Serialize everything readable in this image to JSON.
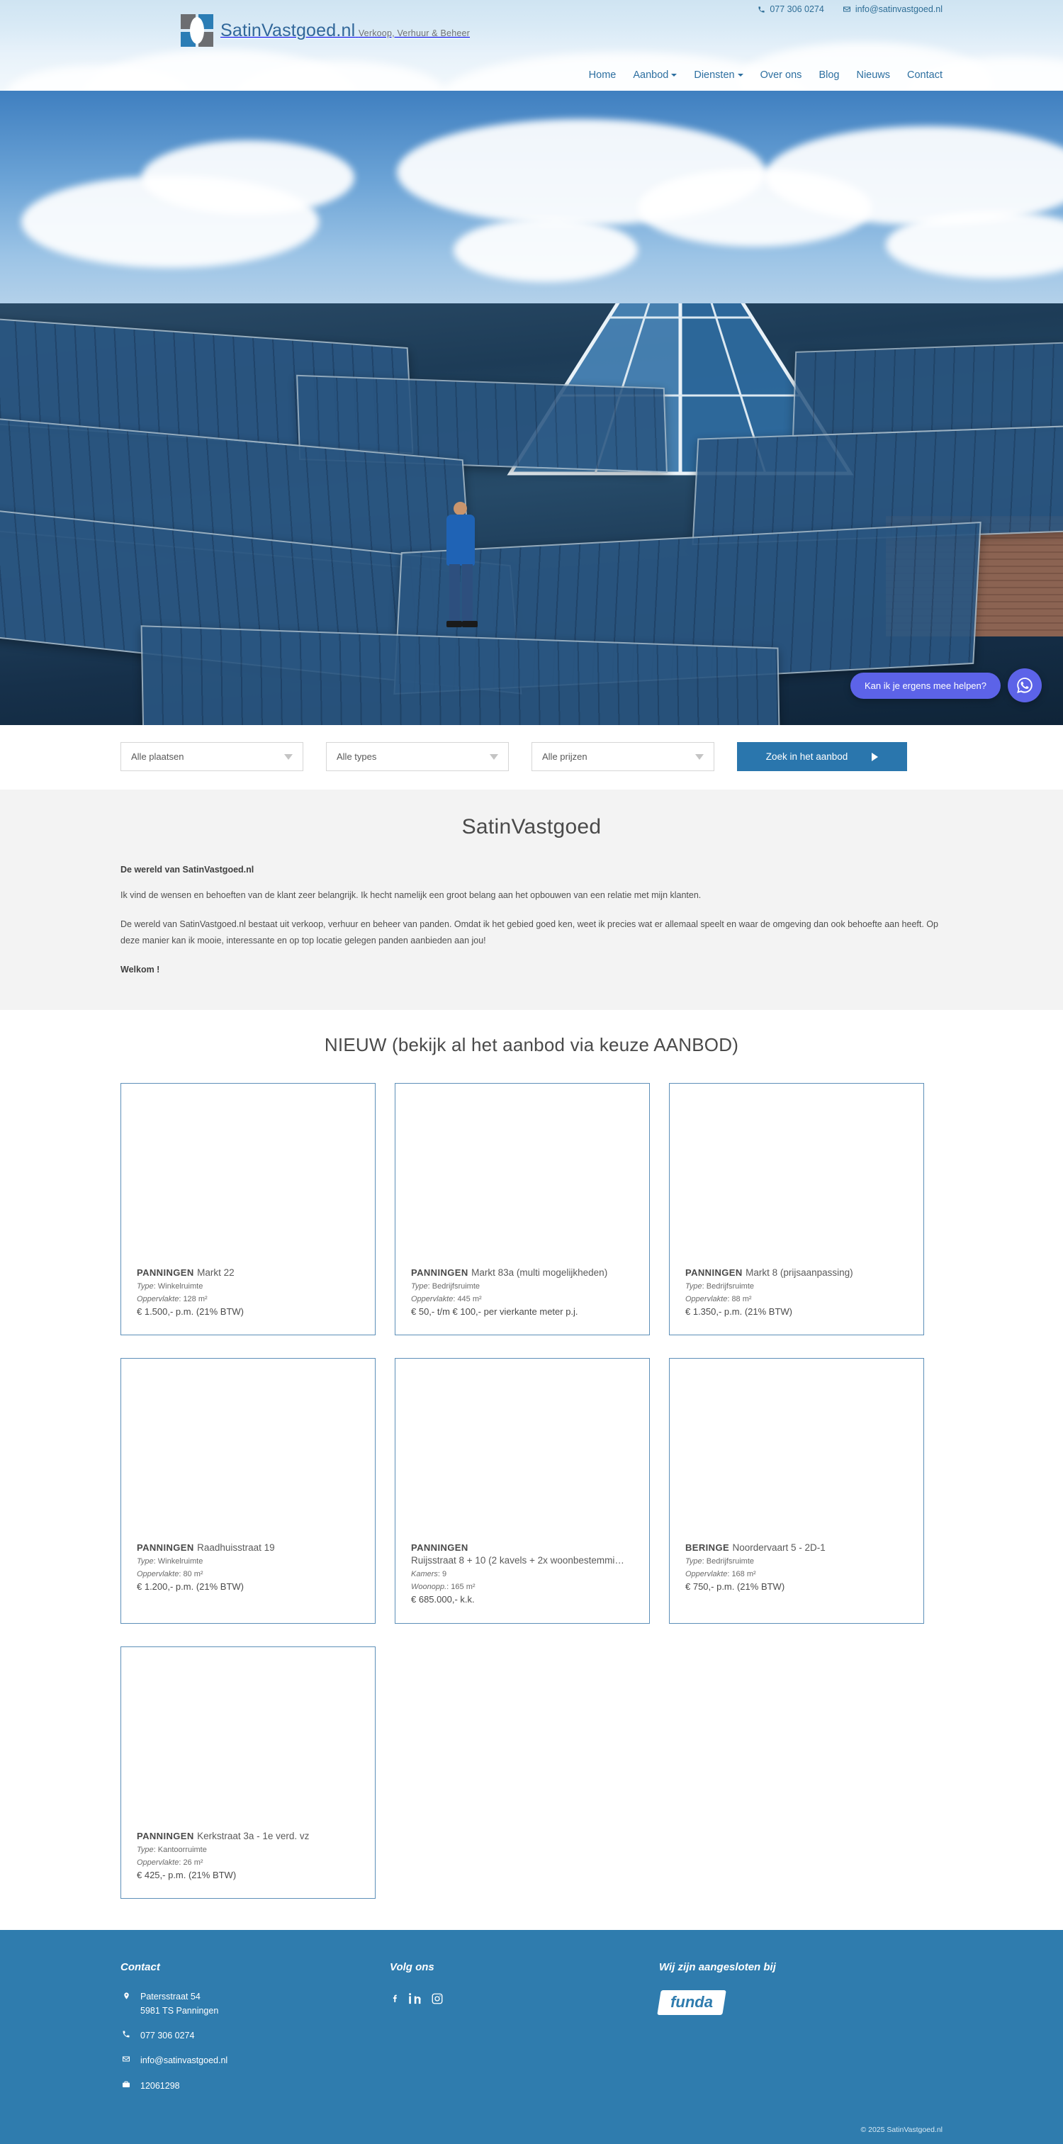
{
  "topbar": {
    "phone": "077 306 0274",
    "email": "info@satinvastgoed.nl",
    "phone_icon": "phone-icon",
    "email_icon": "envelope-icon"
  },
  "logo": {
    "brand": "SatinVastgoed.nl",
    "tagline": "Verkoop, Verhuur & Beheer",
    "colors": {
      "gray": "#6d6e71",
      "blue": "#2b7db5",
      "text": "#31679a"
    }
  },
  "nav": {
    "items": [
      {
        "label": "Home",
        "has_dropdown": false
      },
      {
        "label": "Aanbod",
        "has_dropdown": true
      },
      {
        "label": "Diensten",
        "has_dropdown": true
      },
      {
        "label": "Over ons",
        "has_dropdown": false
      },
      {
        "label": "Blog",
        "has_dropdown": false
      },
      {
        "label": "Nieuws",
        "has_dropdown": false
      },
      {
        "label": "Contact",
        "has_dropdown": false
      }
    ]
  },
  "chat_widget": {
    "message": "Kan ik je ergens mee helpen?",
    "icon": "whatsapp-icon",
    "color": "#5c63e8"
  },
  "search": {
    "filters": [
      {
        "name": "plaatsen",
        "value": "Alle plaatsen"
      },
      {
        "name": "types",
        "value": "Alle types"
      },
      {
        "name": "prijzen",
        "value": "Alle prijzen"
      }
    ],
    "button_label": "Zoek in het aanbod",
    "button_color": "#2a76ad"
  },
  "intro": {
    "title": "SatinVastgoed",
    "subtitle": "De wereld van SatinVastgoed.nl",
    "paragraph1": "Ik vind de wensen en behoeften van de klant zeer belangrijk. Ik hecht namelijk een groot belang aan het opbouwen van een relatie met mijn klanten.",
    "paragraph2": "De wereld van SatinVastgoed.nl bestaat uit verkoop, verhuur en beheer van panden. Omdat ik het gebied goed ken, weet ik precies wat er allemaal speelt en waar de omgeving dan ook behoefte aan heeft. Op deze manier kan ik mooie, interessante en op top locatie gelegen panden aanbieden aan jou!",
    "welkom": "Welkom !"
  },
  "listings": {
    "heading": "NIEUW (bekijk al het aanbod via keuze AANBOD)",
    "cards": [
      {
        "city": "PANNINGEN",
        "address": "Markt 22",
        "meta": [
          {
            "label": "Type",
            "value": "Winkelruimte"
          },
          {
            "label": "Oppervlakte",
            "value": "128 m²"
          }
        ],
        "price": "€ 1.500,- p.m. (21% BTW)"
      },
      {
        "city": "PANNINGEN",
        "address": "Markt 83a (multi mogelijkheden)",
        "meta": [
          {
            "label": "Type",
            "value": "Bedrijfsruimte"
          },
          {
            "label": "Oppervlakte",
            "value": "445 m²"
          }
        ],
        "price": "€ 50,- t/m € 100,- per vierkante meter p.j."
      },
      {
        "city": "PANNINGEN",
        "address": "Markt 8 (prijsaanpassing)",
        "meta": [
          {
            "label": "Type",
            "value": "Bedrijfsruimte"
          },
          {
            "label": "Oppervlakte",
            "value": "88 m²"
          }
        ],
        "price": "€ 1.350,- p.m. (21% BTW)"
      },
      {
        "city": "PANNINGEN",
        "address": "Raadhuisstraat 19",
        "meta": [
          {
            "label": "Type",
            "value": "Winkelruimte"
          },
          {
            "label": "Oppervlakte",
            "value": "80 m²"
          }
        ],
        "price": "€ 1.200,- p.m. (21% BTW)"
      },
      {
        "city": "PANNINGEN",
        "address": "Ruijsstraat 8 + 10 (2 kavels + 2x woonbestemmi…",
        "meta": [
          {
            "label": "Kamers",
            "value": "9"
          },
          {
            "label": "Woonopp.",
            "value": "165 m²"
          }
        ],
        "price": "€ 685.000,- k.k."
      },
      {
        "city": "BERINGE",
        "address": "Noordervaart 5 - 2D-1",
        "meta": [
          {
            "label": "Type",
            "value": "Bedrijfsruimte"
          },
          {
            "label": "Oppervlakte",
            "value": "168 m²"
          }
        ],
        "price": "€ 750,- p.m. (21% BTW)"
      },
      {
        "city": "PANNINGEN",
        "address": "Kerkstraat 3a - 1e verd. vz",
        "meta": [
          {
            "label": "Type",
            "value": "Kantoorruimte"
          },
          {
            "label": "Oppervlakte",
            "value": "26 m²"
          }
        ],
        "price": "€ 425,- p.m. (21% BTW)"
      }
    ]
  },
  "footer": {
    "background": "#2f7cae",
    "contact": {
      "heading": "Contact",
      "address_line1": "Patersstraat 54",
      "address_line2": "5981 TS Panningen",
      "phone": "077 306 0274",
      "email": "info@satinvastgoed.nl",
      "kvk": "12061298"
    },
    "social": {
      "heading": "Volg ons",
      "items": [
        {
          "name": "facebook-icon",
          "label": "f"
        },
        {
          "name": "linkedin-icon",
          "label": "in"
        },
        {
          "name": "instagram-icon",
          "label": "□"
        }
      ]
    },
    "affiliation": {
      "heading": "Wij zijn aangesloten bij",
      "logo_text": "funda"
    },
    "copyright": "© 2025 SatinVastgoed.nl"
  }
}
